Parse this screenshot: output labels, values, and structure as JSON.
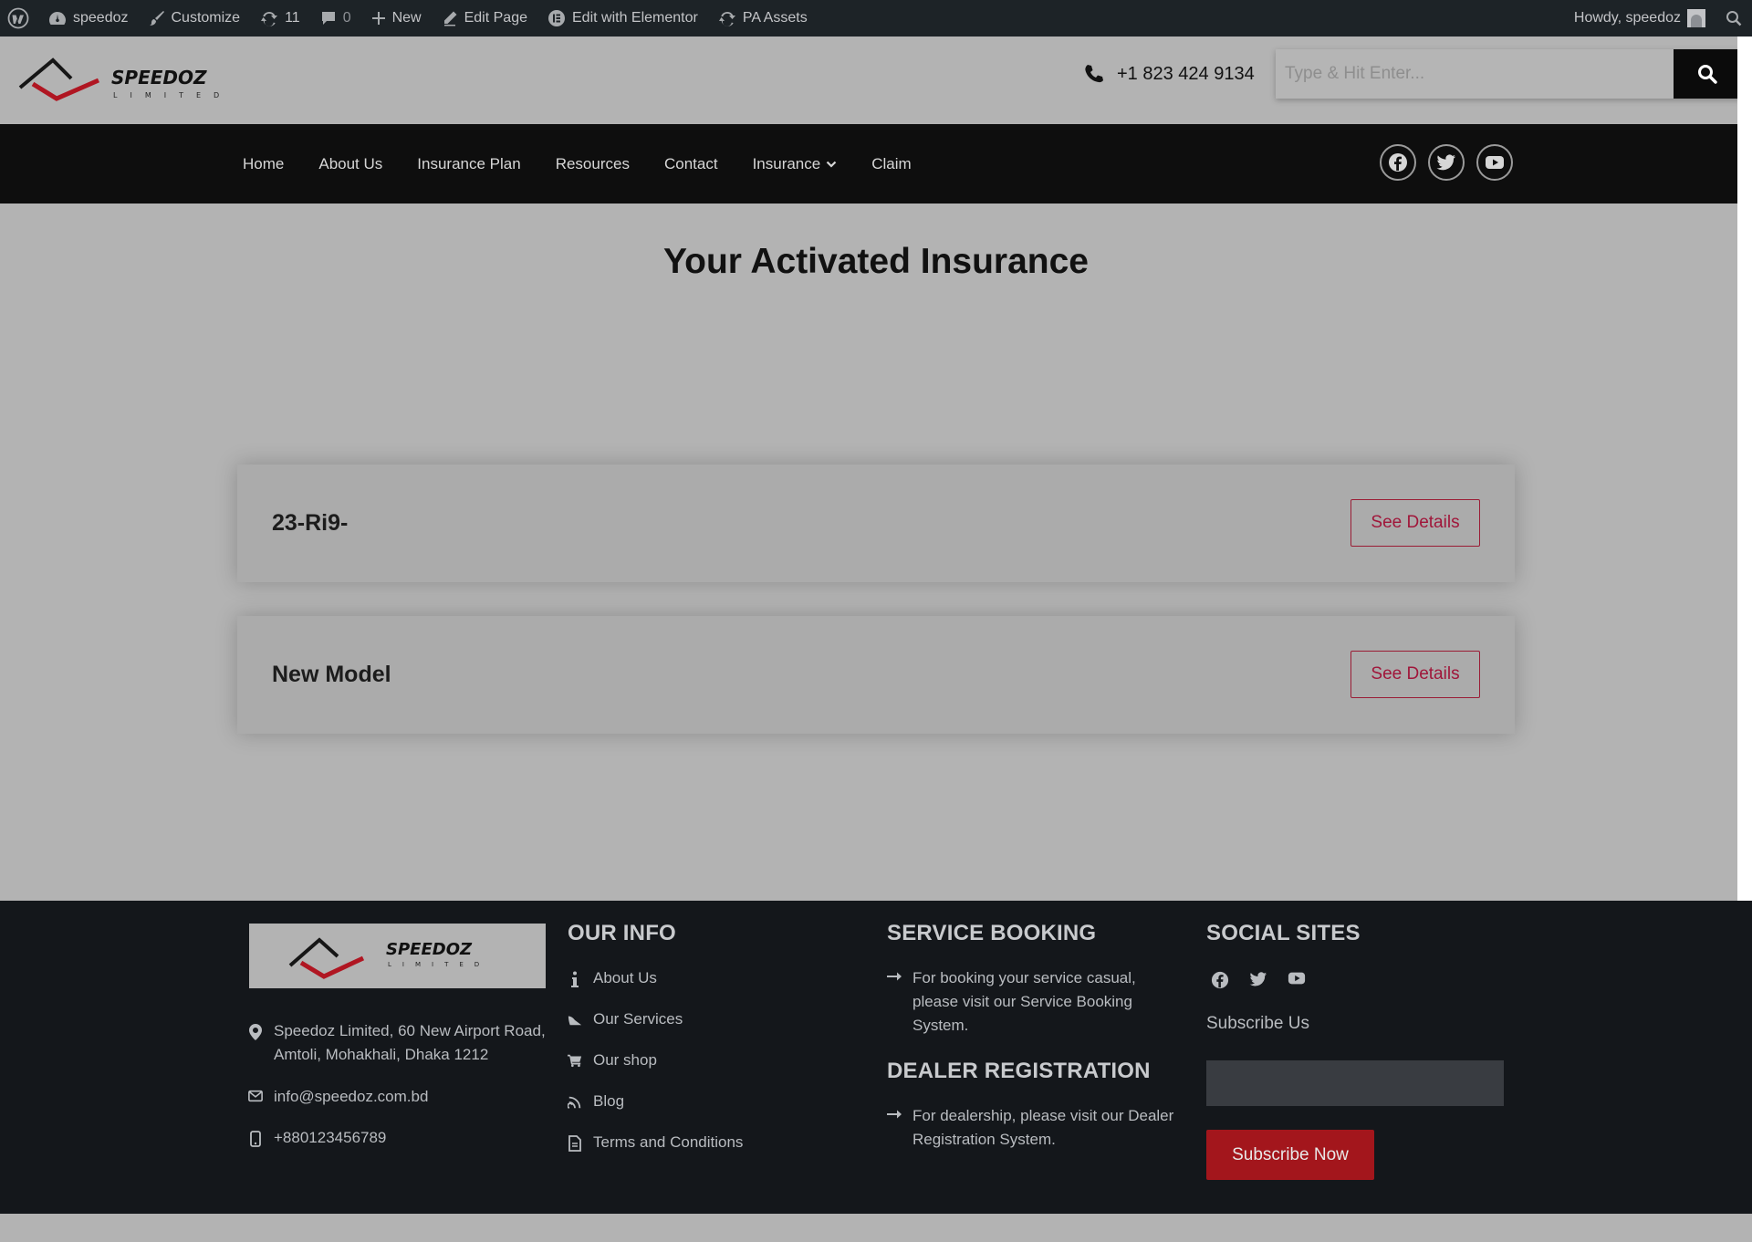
{
  "admin_bar": {
    "site_name": "speedoz",
    "customize": "Customize",
    "updates_count": "11",
    "comments_count": "0",
    "new": "New",
    "edit_page": "Edit Page",
    "edit_elementor": "Edit with Elementor",
    "pa_assets": "PA Assets",
    "howdy": "Howdy, speedoz"
  },
  "header": {
    "logo_text": "SPEEDOZ",
    "logo_sub": "LIMITED",
    "phone": "+1 823 424 9134",
    "search_placeholder": "Type & Hit Enter..."
  },
  "nav": {
    "items": [
      {
        "label": "Home"
      },
      {
        "label": "About Us"
      },
      {
        "label": "Insurance Plan"
      },
      {
        "label": "Resources"
      },
      {
        "label": "Contact"
      },
      {
        "label": "Insurance"
      },
      {
        "label": "Claim"
      }
    ],
    "social_icons": [
      "facebook-icon",
      "twitter-icon",
      "youtube-icon"
    ]
  },
  "main": {
    "title": "Your Activated Insurance",
    "cards": [
      {
        "title": "23-Ri9-",
        "button": "See Details"
      },
      {
        "title": "New Model",
        "button": "See Details"
      }
    ]
  },
  "footer": {
    "address": "Speedoz Limited, 60 New Airport Road, Amtoli, Mohakhali, Dhaka 1212",
    "email": "info@speedoz.com.bd",
    "phone": "+880123456789",
    "our_info": {
      "title": "OUR INFO",
      "links": [
        "About Us",
        "Our Services",
        "Our shop",
        "Blog",
        "Terms and Conditions"
      ]
    },
    "service_booking": {
      "title": "SERVICE BOOKING",
      "text": "For booking your service casual, please visit our Service Booking System."
    },
    "dealer_registration": {
      "title": "DEALER REGISTRATION",
      "text": "For dealership, please visit our Dealer Registration System."
    },
    "social": {
      "title": "SOCIAL SITES",
      "subscribe_label": "Subscribe Us",
      "subscribe_button": "Subscribe Now"
    }
  },
  "colors": {
    "accent_red": "#a3161c",
    "details_red": "#a0163a",
    "nav_bg": "#0e0e0e",
    "footer_bg": "#14171b",
    "admin_bg": "#1d2327"
  }
}
